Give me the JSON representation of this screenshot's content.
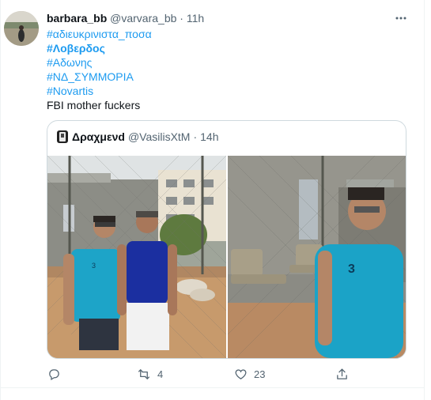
{
  "tweet": {
    "author_name": "barbara_bb",
    "author_handle": "@varvara_bb",
    "separator": "·",
    "time": "11h",
    "lines": [
      {
        "text": "#αδιευκρινιστα_ποσα",
        "kind": "hashtag",
        "bold": false
      },
      {
        "text": "#Λοβερδος",
        "kind": "hashtag",
        "bold": true
      },
      {
        "text": "#Αδωνης",
        "kind": "hashtag",
        "bold": false
      },
      {
        "text": "#ΝΔ_ΣΥΜΜΟΡΙΑ",
        "kind": "hashtag",
        "bold": false
      },
      {
        "text": "#Novartis",
        "kind": "hashtag",
        "bold": false
      },
      {
        "text": "FBI mother fuckers",
        "kind": "text",
        "bold": false
      }
    ],
    "more_icon": "ellipsis-icon"
  },
  "quote": {
    "author_name": "Δραχμενd",
    "author_handle": "@VasilisXtM",
    "separator": "·",
    "time": "14h"
  },
  "actions": {
    "reply_count": "",
    "retweet_count": "4",
    "like_count": "23",
    "icons": [
      "reply-icon",
      "retweet-icon",
      "like-icon",
      "share-icon"
    ]
  },
  "colors": {
    "link": "#1d9bf0",
    "secondary": "#536471",
    "border": "#cfd9de"
  }
}
